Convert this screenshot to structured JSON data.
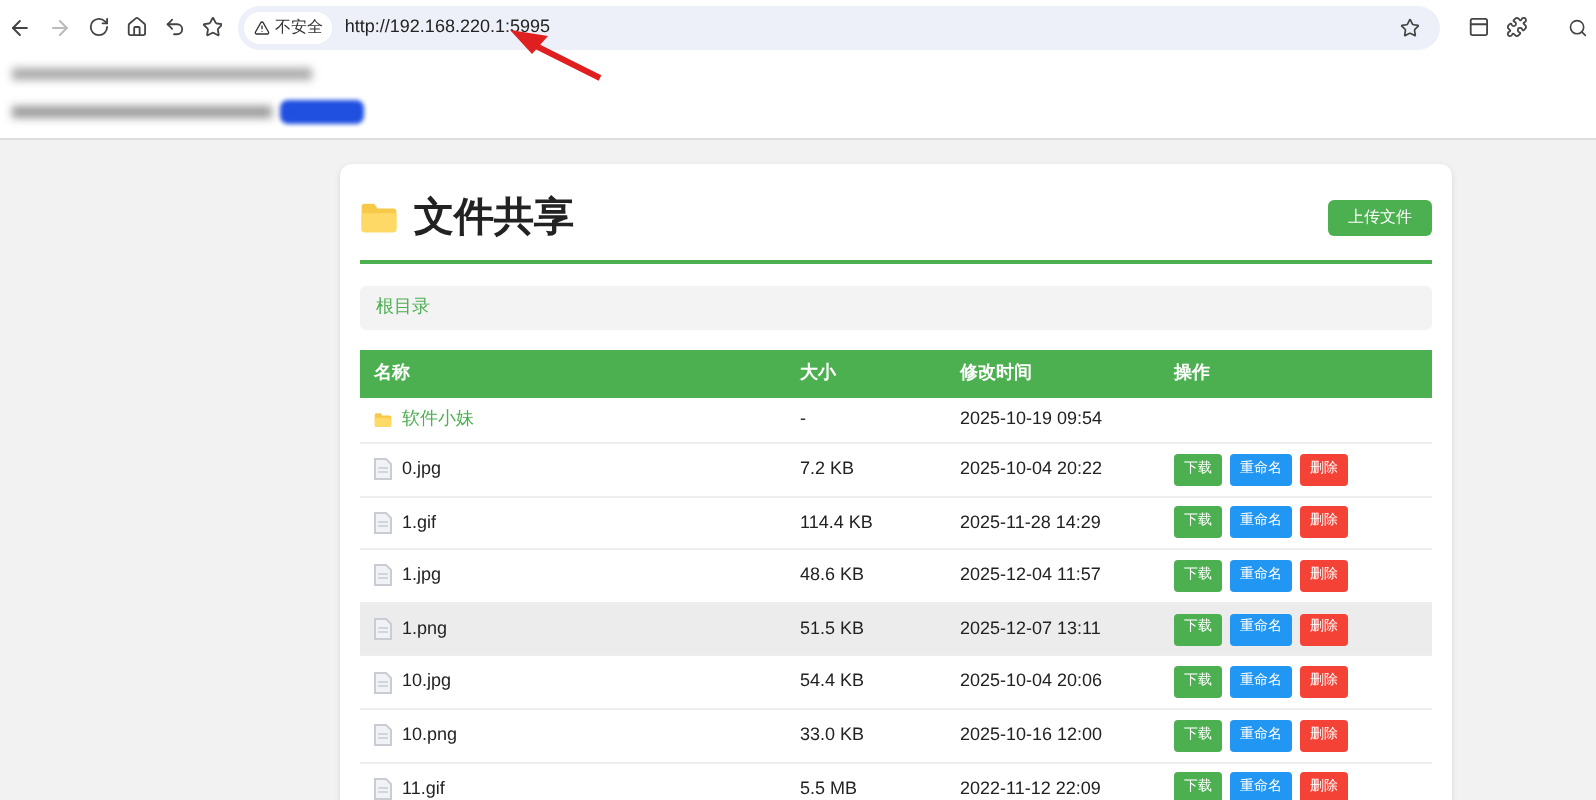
{
  "browser": {
    "security_label": "不安全",
    "url": "http://192.168.220.1:5995"
  },
  "page": {
    "title": "文件共享",
    "upload_button": "上传文件",
    "breadcrumb": "根目录"
  },
  "table": {
    "columns": [
      "名称",
      "大小",
      "修改时间",
      "操作"
    ],
    "rows": [
      {
        "kind": "folder",
        "name": "软件小妹",
        "size": "-",
        "modified": "2025-10-19 09:54",
        "highlighted": false
      },
      {
        "kind": "file",
        "name": "0.jpg",
        "size": "7.2 KB",
        "modified": "2025-10-04 20:22",
        "highlighted": false,
        "actions": [
          "下载",
          "重命名",
          "删除"
        ]
      },
      {
        "kind": "file",
        "name": "1.gif",
        "size": "114.4 KB",
        "modified": "2025-11-28 14:29",
        "highlighted": false,
        "actions": [
          "下载",
          "重命名",
          "删除"
        ]
      },
      {
        "kind": "file",
        "name": "1.jpg",
        "size": "48.6 KB",
        "modified": "2025-12-04 11:57",
        "highlighted": false,
        "actions": [
          "下载",
          "重命名",
          "删除"
        ]
      },
      {
        "kind": "file",
        "name": "1.png",
        "size": "51.5 KB",
        "modified": "2025-12-07 13:11",
        "highlighted": true,
        "actions": [
          "下载",
          "重命名",
          "删除"
        ]
      },
      {
        "kind": "file",
        "name": "10.jpg",
        "size": "54.4 KB",
        "modified": "2025-10-04 20:06",
        "highlighted": false,
        "actions": [
          "下载",
          "重命名",
          "删除"
        ]
      },
      {
        "kind": "file",
        "name": "10.png",
        "size": "33.0 KB",
        "modified": "2025-10-16 12:00",
        "highlighted": false,
        "actions": [
          "下载",
          "重命名",
          "删除"
        ]
      },
      {
        "kind": "file",
        "name": "11.gif",
        "size": "5.5 MB",
        "modified": "2022-11-12 22:09",
        "highlighted": false,
        "actions": [
          "下载",
          "重命名",
          "删除"
        ]
      }
    ]
  }
}
